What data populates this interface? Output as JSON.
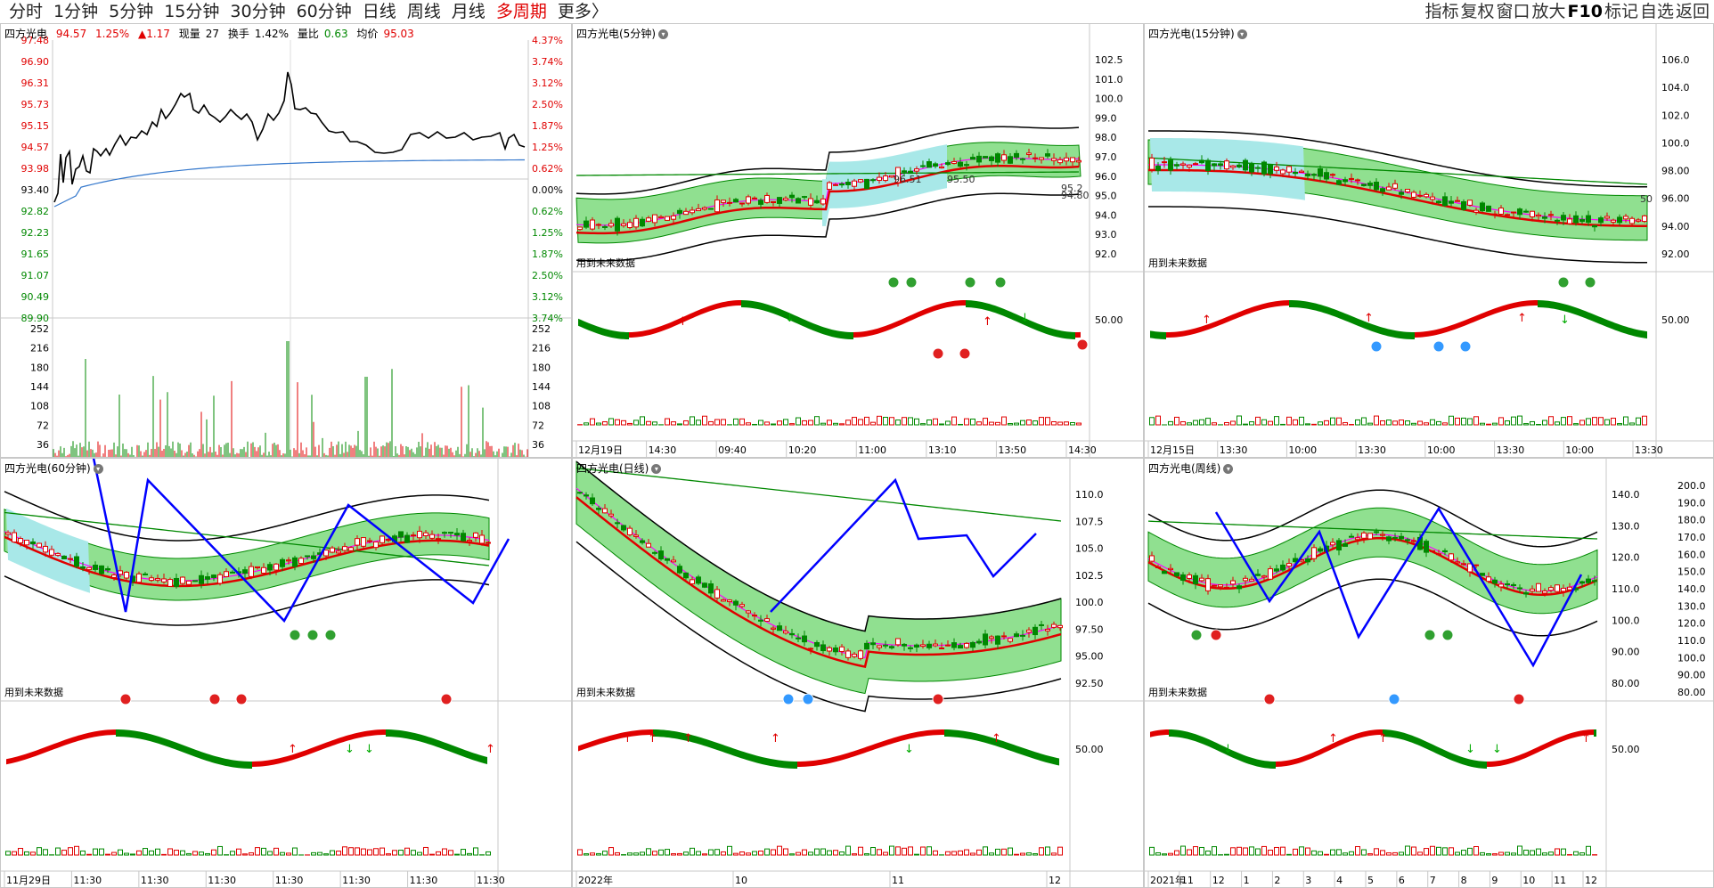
{
  "toolbar": {
    "periods": [
      "分时",
      "1分钟",
      "5分钟",
      "15分钟",
      "30分钟",
      "60分钟",
      "日线",
      "周线",
      "月线",
      "多周期",
      "更多〉"
    ],
    "active_period": "多周期",
    "tools": [
      "指标",
      "复权",
      "窗口",
      "放大",
      "F10",
      "标记",
      "自选",
      "返回"
    ]
  },
  "intraday": {
    "name": "四方光电",
    "price": "94.57",
    "pct": "1.25%",
    "change": "▲1.17",
    "volume_label": "现量",
    "volume": "27",
    "turnover_label": "换手",
    "turnover": "1.42%",
    "ratio_label": "量比",
    "ratio": "0.63",
    "avg_label": "均价",
    "avg": "95.03",
    "price_ticks": [
      "97.48",
      "96.90",
      "96.31",
      "95.73",
      "95.15",
      "94.57",
      "93.98",
      "93.40",
      "92.82",
      "92.23",
      "91.65",
      "91.07",
      "90.49",
      "89.90"
    ],
    "pct_ticks": [
      "4.37%",
      "3.74%",
      "3.12%",
      "2.50%",
      "1.87%",
      "1.25%",
      "0.62%",
      "0.00%",
      "0.62%",
      "1.25%",
      "1.87%",
      "2.50%",
      "3.12%",
      "3.74%"
    ],
    "vol_ticks": [
      "252",
      "216",
      "180",
      "144",
      "108",
      "72",
      "36"
    ]
  },
  "panels": [
    {
      "title": "四方光电(5分钟)",
      "note": "用到未来数据",
      "axis": [
        "102.5",
        "101.0",
        "100.0",
        "99.0",
        "98.0",
        "97.0",
        "96.0",
        "95.0",
        "94.0",
        "93.0",
        "92.0"
      ],
      "lower_axis": [
        "50.00"
      ],
      "x": [
        "12月19日",
        "14:30",
        "09:40",
        "10:20",
        "11:00",
        "13:10",
        "13:50",
        "14:30"
      ],
      "labels": [
        "96.51",
        "95.50",
        "95.2",
        "94.80"
      ]
    },
    {
      "title": "四方光电(15分钟)",
      "note": "用到未来数据",
      "axis": [
        "106.0",
        "104.0",
        "102.0",
        "100.0",
        "98.00",
        "96.00",
        "94.00",
        "92.00"
      ],
      "lower_axis": [
        "50.00"
      ],
      "x": [
        "12月15日",
        "13:30",
        "10:00",
        "13:30",
        "10:00",
        "13:30",
        "10:00",
        "13:30"
      ],
      "labels": [
        "50"
      ]
    },
    {
      "title": "四方光电(60分钟)",
      "note": "用到未来数据",
      "axis": [],
      "lower_axis": [],
      "x": [
        "11月29日",
        "11:30",
        "11:30",
        "11:30",
        "11:30",
        "11:30",
        "11:30",
        "11:30"
      ],
      "labels": []
    },
    {
      "title": "四方光电(日线)",
      "note": "用到未来数据",
      "axis": [
        "110.0",
        "107.5",
        "105.0",
        "102.5",
        "100.0",
        "97.50",
        "95.00",
        "92.50"
      ],
      "lower_axis": [
        "50.00"
      ],
      "x": [
        "2022年",
        "10",
        "11",
        "12"
      ],
      "labels": []
    },
    {
      "title": "四方光电(周线)",
      "note": "用到未来数据",
      "axis": [
        "140.0",
        "130.0",
        "120.0",
        "110.0",
        "100.0",
        "90.00",
        "80.00"
      ],
      "right_axis": [
        "200.0",
        "190.0",
        "180.0",
        "170.0",
        "160.0",
        "150.0",
        "140.0",
        "130.0",
        "120.0",
        "110.0",
        "100.0",
        "90.00",
        "80.00"
      ],
      "lower_axis": [
        "50.00"
      ],
      "x": [
        "2021年",
        "11",
        "12",
        "1",
        "2",
        "3",
        "4",
        "5",
        "6",
        "7",
        "8",
        "9",
        "10",
        "11",
        "12"
      ],
      "labels": []
    }
  ],
  "colors": {
    "up": "#e00000",
    "down": "#008800",
    "ribbon": "#90e090",
    "cyan": "#a8e8e8",
    "blue": "#0000ff",
    "magenta": "#ff00ff"
  }
}
